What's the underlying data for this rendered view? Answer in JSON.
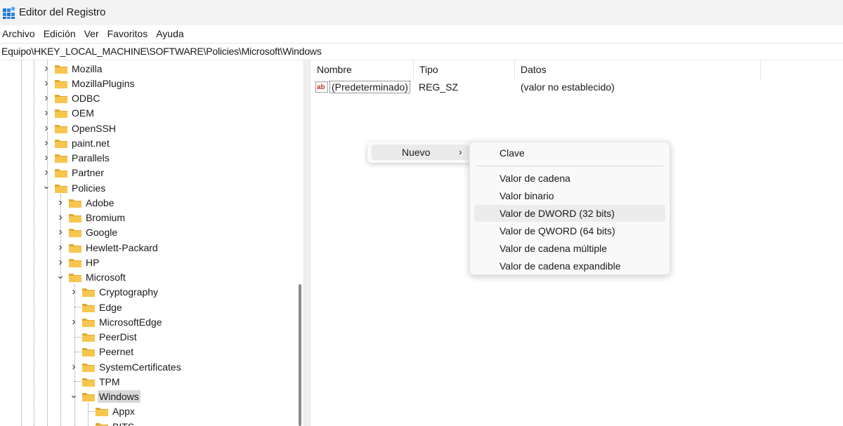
{
  "window": {
    "title": "Editor del Registro"
  },
  "menu": [
    "Archivo",
    "Edición",
    "Ver",
    "Favoritos",
    "Ayuda"
  ],
  "address": "Equipo\\HKEY_LOCAL_MACHINE\\SOFTWARE\\Policies\\Microsoft\\Windows",
  "tree": {
    "level1": [
      "Mozilla",
      "MozillaPlugins",
      "ODBC",
      "OEM",
      "OpenSSH",
      "paint.net",
      "Parallels",
      "Partner",
      "Policies"
    ],
    "policies_children": [
      "Adobe",
      "Bromium",
      "Google",
      "Hewlett-Packard",
      "HP",
      "Microsoft"
    ],
    "microsoft_children": [
      "Cryptography",
      "Edge",
      "MicrosoftEdge",
      "PeerDist",
      "Peernet",
      "SystemCertificates",
      "TPM",
      "Windows"
    ],
    "windows_children": [
      "Appx",
      "BITS"
    ],
    "selected": "Windows"
  },
  "list": {
    "columns": [
      "Nombre",
      "Tipo",
      "Datos"
    ],
    "rows": [
      {
        "name": "(Predeterminado)",
        "type": "REG_SZ",
        "data": "(valor no establecido)"
      }
    ]
  },
  "context_menu": {
    "parent_label": "Nuevo",
    "items": [
      "Clave",
      "Valor de cadena",
      "Valor binario",
      "Valor de DWORD (32 bits)",
      "Valor de QWORD (64 bits)",
      "Valor de cadena múltiple",
      "Valor de cadena expandible"
    ],
    "hovered": "Valor de DWORD (32 bits)"
  },
  "icons": {
    "app": "registry-editor-icon",
    "folder": "folder-icon",
    "value": "string-value-icon"
  },
  "colors": {
    "folder": "#f6c64e",
    "folder_dark": "#e0a92c",
    "selected": "#d9d9d9",
    "menu_bg": "#f9f9f9"
  }
}
